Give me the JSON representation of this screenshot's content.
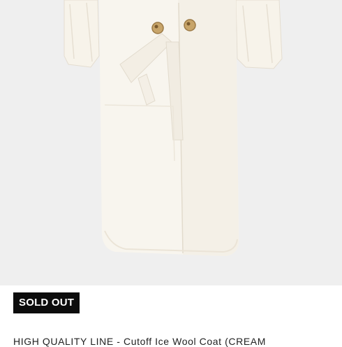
{
  "product": {
    "image_alt": "white wool coat",
    "sold_out_label": "SOLD OUT",
    "title": "HIGH QUALITY LINE - Cutoff Ice Wool Coat (CREAM"
  },
  "colors": {
    "image_background": "#efefef",
    "coat": "#f7f3ea",
    "badge_background": "#0c0c0c",
    "badge_text": "#ffffff",
    "button": "#c8a56a"
  }
}
